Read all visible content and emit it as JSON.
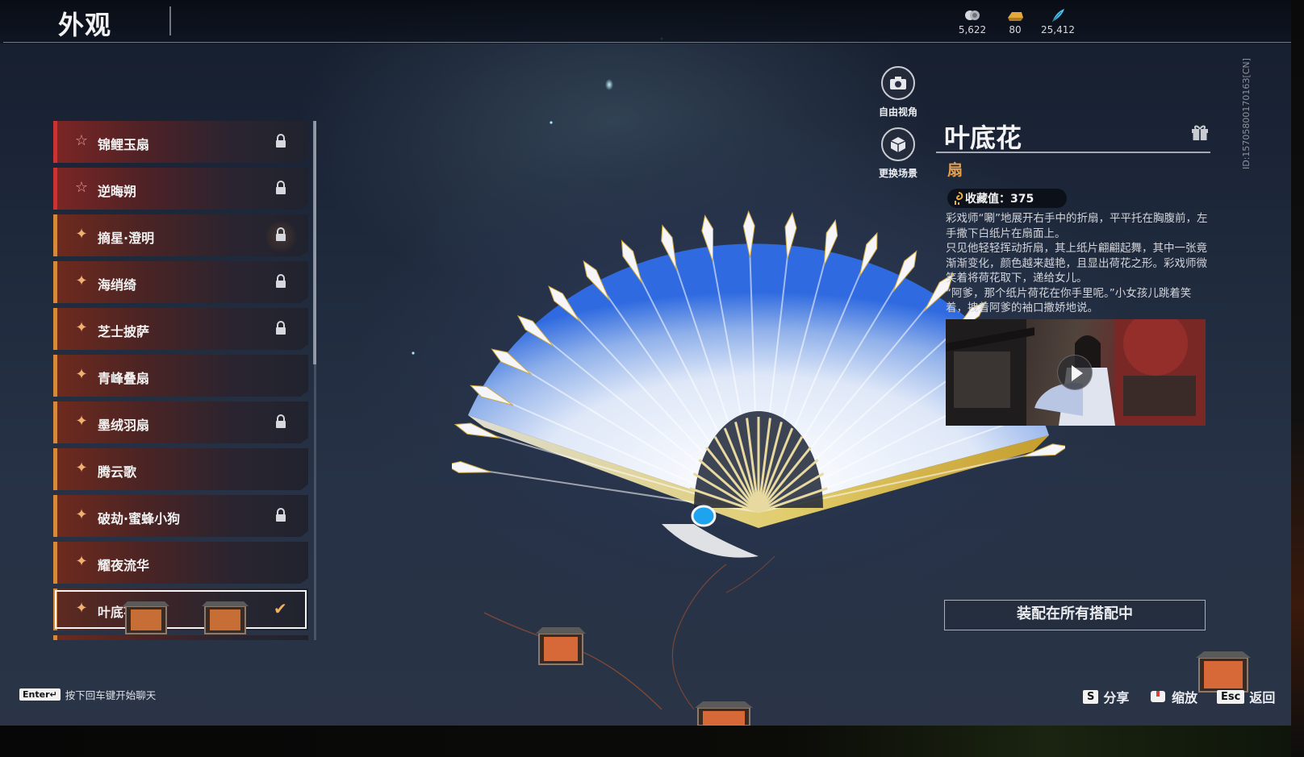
{
  "page": {
    "title": "外观"
  },
  "currencies": [
    {
      "name": "currency-1",
      "icon": "coin-stack-icon",
      "value": "5,622"
    },
    {
      "name": "currency-2",
      "icon": "gold-ingot-icon",
      "value": "80"
    },
    {
      "name": "currency-3",
      "icon": "feather-icon",
      "value": "25,412"
    }
  ],
  "list": {
    "items": [
      {
        "label": "锦鲤玉扇",
        "icon": "star-outline-icon",
        "tier": "red",
        "locked": true
      },
      {
        "label": "逆晦朔",
        "icon": "star-outline-icon",
        "tier": "red",
        "locked": true
      },
      {
        "label": "摘星·澄明",
        "icon": "cross-sparkle-icon",
        "tier": "gold",
        "locked": true
      },
      {
        "label": "海绡绮",
        "icon": "cross-sparkle-icon",
        "tier": "gold",
        "locked": true
      },
      {
        "label": "芝士披萨",
        "icon": "cross-sparkle-icon",
        "tier": "gold",
        "locked": true
      },
      {
        "label": "青峰叠扇",
        "icon": "cross-sparkle-icon",
        "tier": "gold",
        "locked": false
      },
      {
        "label": "墨绒羽扇",
        "icon": "cross-sparkle-icon",
        "tier": "gold",
        "locked": true
      },
      {
        "label": "腾云歌",
        "icon": "cross-sparkle-icon",
        "tier": "gold",
        "locked": false
      },
      {
        "label": "破劫·蜜蜂小狗",
        "icon": "cross-sparkle-icon",
        "tier": "gold",
        "locked": true
      },
      {
        "label": "耀夜流华",
        "icon": "cross-sparkle-icon",
        "tier": "gold",
        "locked": false
      },
      {
        "label": "叶底花",
        "icon": "cross-sparkle-icon",
        "tier": "gold",
        "locked": false,
        "selected": true
      }
    ]
  },
  "camera": {
    "free_view_label": "自由视角",
    "change_scene_label": "更换场景"
  },
  "detail": {
    "name": "叶底花",
    "type": "扇",
    "collect_label": "收藏值：375",
    "description": "彩戏师“唰”地展开右手中的折扇，平平托在胸腹前，左手撒下白纸片在扇面上。\n只见他轻轻挥动折扇，其上纸片翩翩起舞，其中一张竟渐渐变化，颜色越来越艳，且显出荷花之形。彩戏师微笑着将荷花取下，递给女儿。\n“阿爹，那个纸片荷花在你手里呢。”小女孩儿跳着笑着，拽着阿爹的袖口撒娇地说。",
    "equip_all_label": "装配在所有搭配中",
    "id_text": "ID:1570580017016З[CN]"
  },
  "footer": {
    "chat_key": "Enter↵",
    "chat_hint": "按下回车键开始聊天",
    "share_key": "S",
    "share_label": "分享",
    "zoom_label": "缩放",
    "back_key": "Esc",
    "back_label": "返回"
  },
  "colors": {
    "accent_gold": "#e6a04c",
    "tier_red": "#c83434",
    "tier_gold": "#d48a3a"
  }
}
